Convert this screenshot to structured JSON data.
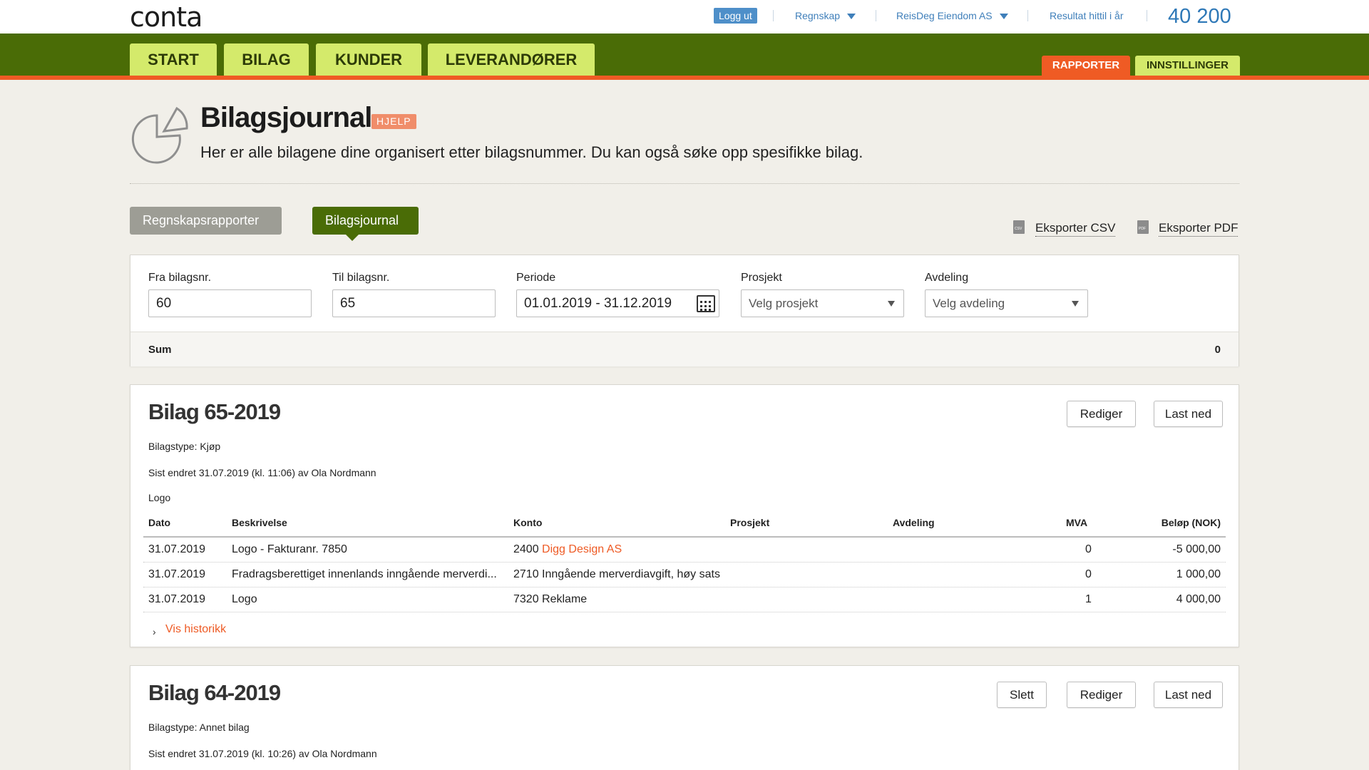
{
  "app": {
    "logo": "conta",
    "logout": "Logg ut",
    "menu": "Regnskap",
    "company": "ReisDeg Eiendom AS",
    "result_label": "Resultat hittil i år",
    "result_value": "40 200"
  },
  "nav": {
    "tabs": [
      "START",
      "BILAG",
      "KUNDER",
      "LEVERANDØRER"
    ],
    "right_tabs": [
      "RAPPORTER",
      "INNSTILLINGER"
    ]
  },
  "header": {
    "title": "Bilagsjournal",
    "help": "HJELP",
    "subtitle": "Her er alle bilagene dine organisert etter bilagsnummer. Du kan også søke opp spesifikke bilag."
  },
  "subtabs": [
    "Regnskapsrapporter",
    "Bilagsjournal"
  ],
  "exports": {
    "csv": "Eksporter CSV",
    "pdf": "Eksporter PDF",
    "csv_icon_text": "CSV",
    "pdf_icon_text": "PDF"
  },
  "filters": {
    "from_label": "Fra bilagsnr.",
    "from_value": "60",
    "to_label": "Til bilagsnr.",
    "to_value": "65",
    "period_label": "Periode",
    "period_value": "01.01.2019 - 31.12.2019",
    "project_label": "Prosjekt",
    "project_value": "Velg prosjekt",
    "dept_label": "Avdeling",
    "dept_value": "Velg avdeling",
    "sum_label": "Sum",
    "sum_value": "0"
  },
  "vouchers": [
    {
      "title": "Bilag 65-2019",
      "type": "Bilagstype: Kjøp",
      "changed": "Sist endret 31.07.2019 (kl. 11:06) av Ola Nordmann",
      "description": "Logo",
      "buttons": [
        "Rediger",
        "Last ned"
      ],
      "columns": [
        "Dato",
        "Beskrivelse",
        "Konto",
        "Prosjekt",
        "Avdeling",
        "MVA",
        "Beløp (NOK)"
      ],
      "rows": [
        {
          "date": "31.07.2019",
          "desc": "Logo - Fakturanr. 7850",
          "account_no": "2400",
          "account_name": "Digg Design AS",
          "mva": "0",
          "amount": "-5 000,00"
        },
        {
          "date": "31.07.2019",
          "desc": "Fradragsberettiget innenlands inngående merverdi...",
          "account_no": "2710",
          "account_name": "Inngående merverdiavgift, høy sats",
          "mva": "0",
          "amount": "1 000,00"
        },
        {
          "date": "31.07.2019",
          "desc": "Logo",
          "account_no": "7320",
          "account_name": "Reklame",
          "mva": "1",
          "amount": "4 000,00"
        }
      ],
      "history": "Vis historikk"
    },
    {
      "title": "Bilag 64-2019",
      "type": "Bilagstype: Annet bilag",
      "changed": "Sist endret 31.07.2019 (kl. 10:26) av Ola Nordmann",
      "buttons": [
        "Slett",
        "Rediger",
        "Last ned"
      ]
    }
  ]
}
